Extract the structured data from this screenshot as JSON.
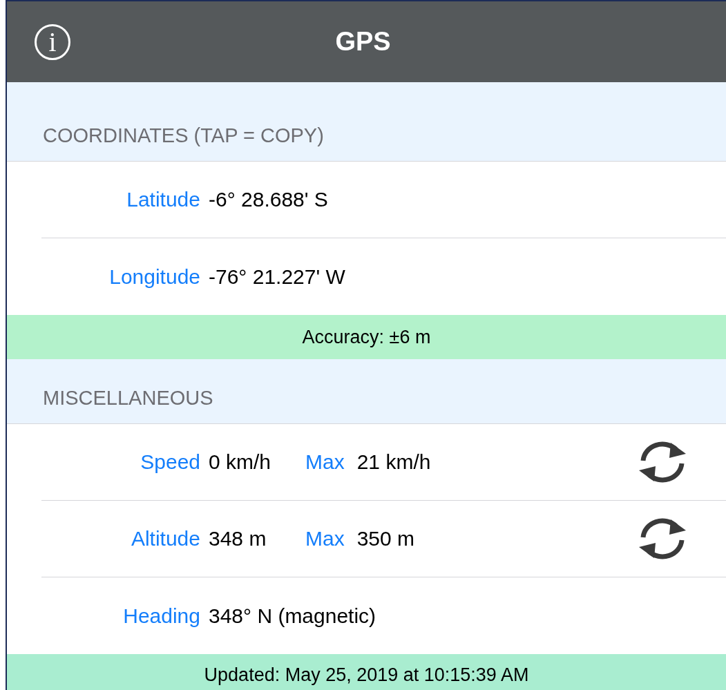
{
  "header": {
    "title": "GPS",
    "info_icon": "i"
  },
  "coordinates": {
    "title": "COORDINATES (TAP = COPY)",
    "rows": [
      {
        "kind": "plain",
        "label": "Latitude",
        "value": "-6° 28.688' S"
      },
      {
        "kind": "plain",
        "label": "Longitude",
        "value": "-76° 21.227' W"
      }
    ]
  },
  "accuracy": "Accuracy: ±6 m",
  "miscellaneous": {
    "title": "MISCELLANEOUS",
    "rows": [
      {
        "kind": "with_max",
        "label": "Speed",
        "value": "0 km/h",
        "max_label": "Max",
        "max_value": "21 km/h"
      },
      {
        "kind": "with_max",
        "label": "Altitude",
        "value": "348 m",
        "max_label": "Max",
        "max_value": "350 m"
      },
      {
        "kind": "plain",
        "label": "Heading",
        "value": "348° N (magnetic)"
      }
    ]
  },
  "updated": "Updated: May 25, 2019 at 10:15:39 AM"
}
